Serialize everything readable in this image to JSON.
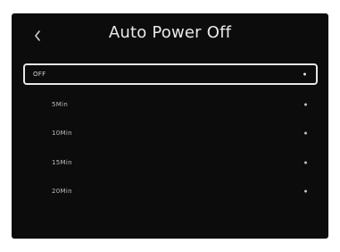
{
  "header": {
    "back_icon": "chevron-left-icon",
    "title": "Auto Power Off"
  },
  "options": [
    {
      "label": "OFF",
      "selected": true
    },
    {
      "label": "5Min",
      "selected": false
    },
    {
      "label": "10Min",
      "selected": false
    },
    {
      "label": "15Min",
      "selected": false
    },
    {
      "label": "20Min",
      "selected": false
    }
  ],
  "colors": {
    "background": "#0c0c0c",
    "text": "#e9e9e9",
    "selection_border": "#e6e6e6"
  }
}
